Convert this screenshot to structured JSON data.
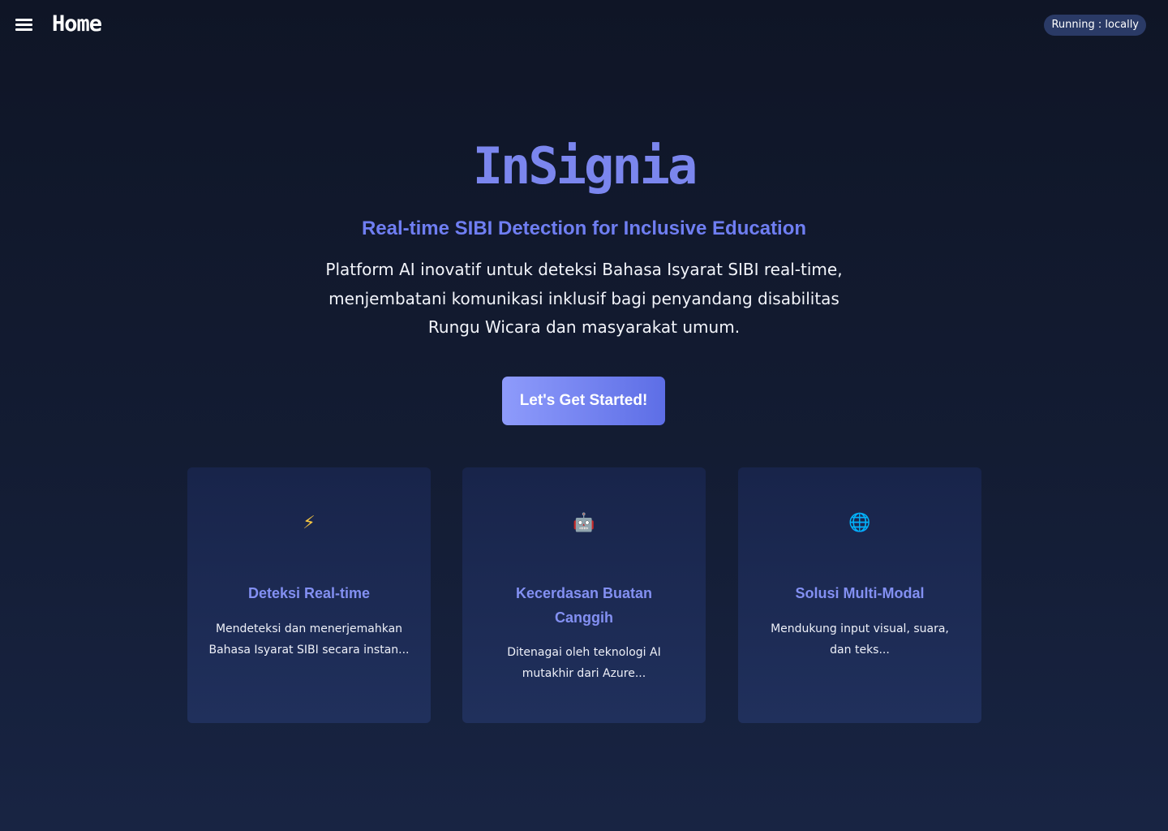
{
  "header": {
    "title": "Home",
    "status": "Running : locally"
  },
  "hero": {
    "brand": "InSignia",
    "tagline": "Real-time SIBI Detection for Inclusive Education",
    "description": "Platform AI inovatif untuk deteksi Bahasa Isyarat SIBI real-time, menjembatani komunikasi inklusif bagi penyandang disabilitas Rungu Wicara dan masyarakat umum.",
    "cta_label": "Let's Get Started!"
  },
  "features": [
    {
      "icon": "lightning-icon",
      "glyph": "⚡",
      "title": "Deteksi Real-time",
      "text": "Mendeteksi dan menerjemahkan Bahasa Isyarat SIBI secara instan..."
    },
    {
      "icon": "robot-icon",
      "glyph": "🤖",
      "title": "Kecerdasan Buatan Canggih",
      "text": "Ditenagai oleh teknologi AI mutakhir dari Azure..."
    },
    {
      "icon": "globe-icon",
      "glyph": "🌐",
      "title": "Solusi Multi-Modal",
      "text": "Mendukung input visual, suara, dan teks..."
    }
  ],
  "colors": {
    "background": "#0f1526",
    "accent": "#7b86ee",
    "card": "#1c2a52",
    "badge": "#2a3a66"
  }
}
